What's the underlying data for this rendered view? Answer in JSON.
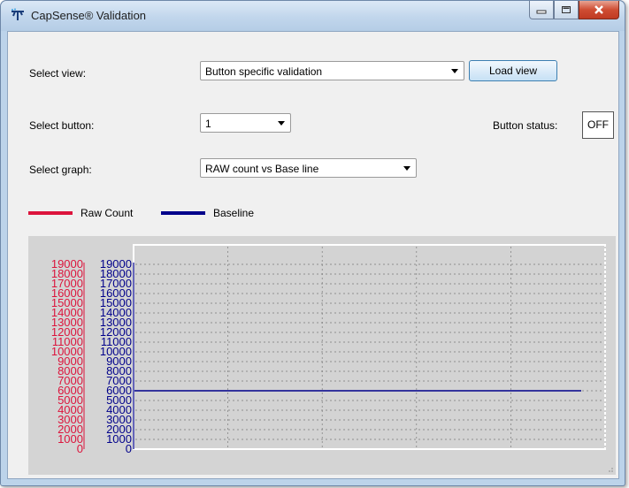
{
  "window": {
    "title": "CapSense® Validation"
  },
  "controls": {
    "select_view_label": "Select view:",
    "view_value": "Button specific validation",
    "load_view_label": "Load view",
    "select_button_label": "Select button:",
    "button_value": "1",
    "button_status_label": "Button status:",
    "button_status_value": "OFF",
    "select_graph_label": "Select graph:",
    "graph_value": "RAW count vs Base line"
  },
  "colors": {
    "raw": "#dc143c",
    "baseline": "#00008b",
    "chart_bg": "#d4d4d4",
    "plot_bg": "#d3d3d3"
  },
  "chart_data": {
    "type": "line",
    "series": [
      {
        "name": "Raw Count",
        "values": []
      },
      {
        "name": "Baseline",
        "values": [
          6000,
          6000
        ]
      }
    ],
    "x": [
      0,
      1
    ],
    "ylim": [
      0,
      19000
    ],
    "y_ticks": [
      0,
      1000,
      2000,
      3000,
      4000,
      5000,
      6000,
      7000,
      8000,
      9000,
      10000,
      11000,
      12000,
      13000,
      14000,
      15000,
      16000,
      17000,
      18000,
      19000
    ],
    "grid": true,
    "legend_placement": "top-left"
  }
}
